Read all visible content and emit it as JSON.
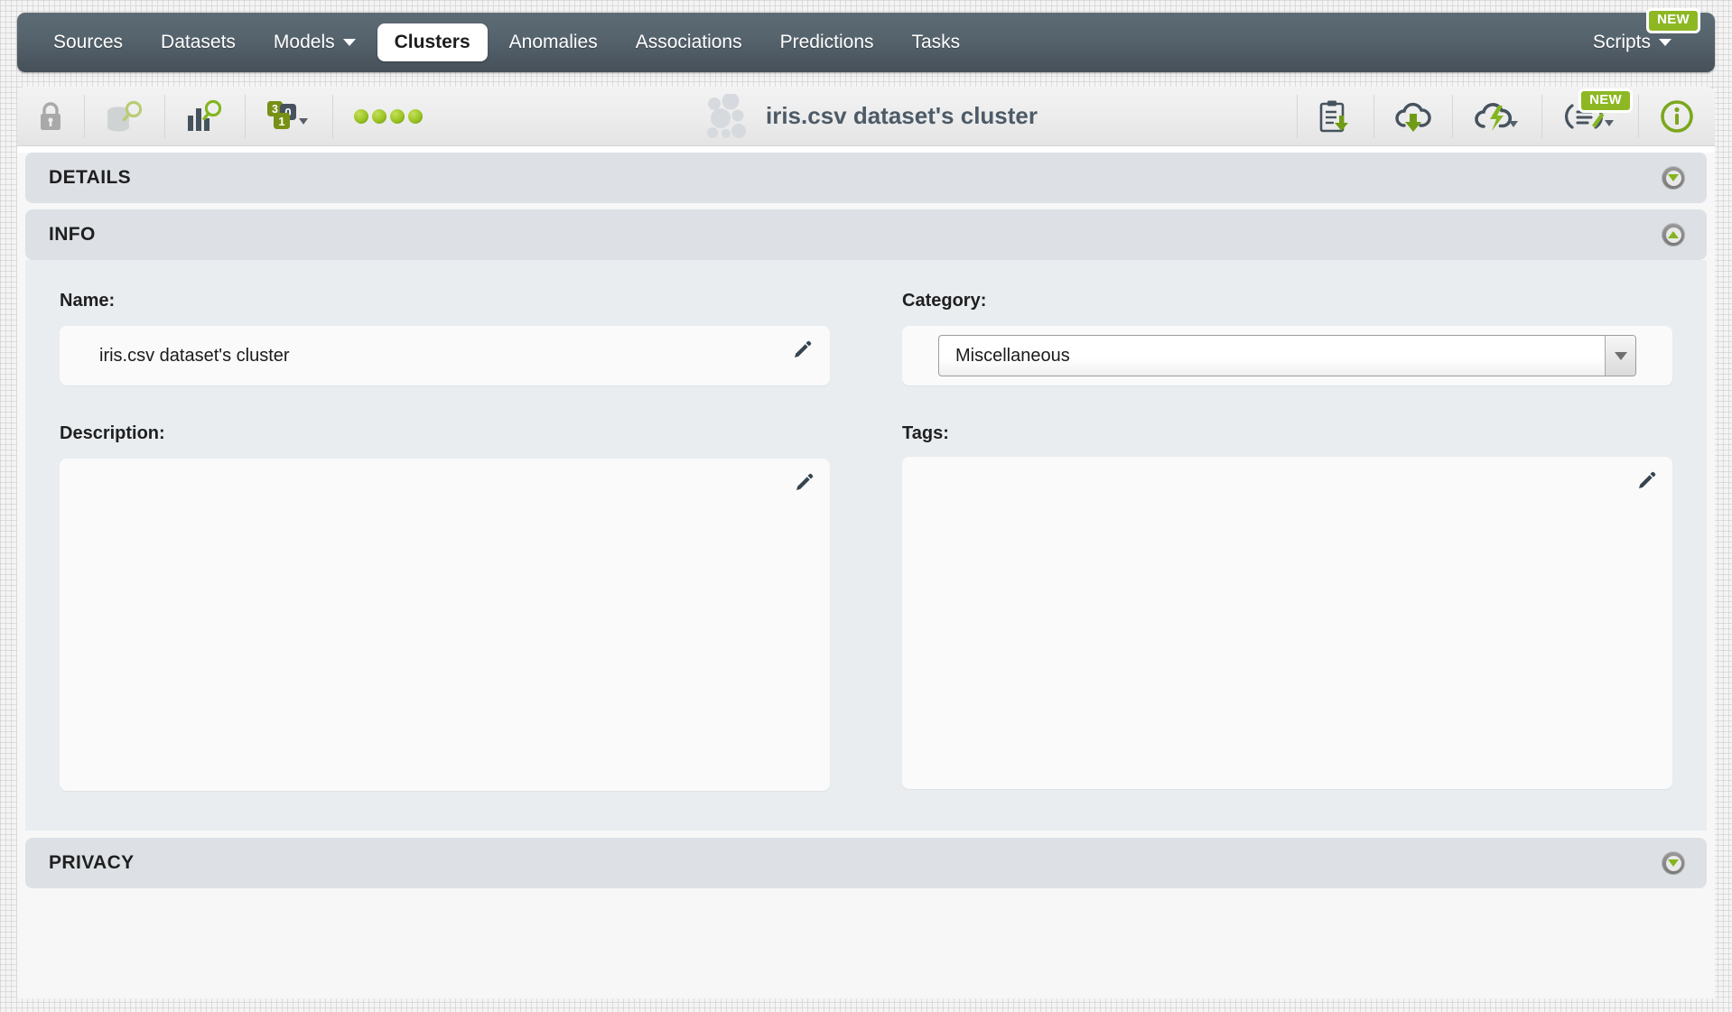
{
  "nav": {
    "items": [
      {
        "label": "Sources",
        "icon": "",
        "active": false,
        "caret": false
      },
      {
        "label": "Datasets",
        "icon": "",
        "active": false,
        "caret": false
      },
      {
        "label": "Models",
        "icon": "",
        "active": false,
        "caret": true
      },
      {
        "label": "Clusters",
        "icon": "",
        "active": true,
        "caret": false
      },
      {
        "label": "Anomalies",
        "icon": "",
        "active": false,
        "caret": false
      },
      {
        "label": "Associations",
        "icon": "",
        "active": false,
        "caret": false
      },
      {
        "label": "Predictions",
        "icon": "",
        "active": false,
        "caret": false
      },
      {
        "label": "Tasks",
        "icon": "",
        "active": false,
        "caret": false
      }
    ],
    "scripts_label": "Scripts",
    "scripts_badge": "NEW",
    "bar_color": "#4e5a64",
    "active_tab_bg": "#ffffff"
  },
  "toolbar": {
    "title": "iris.csv dataset's cluster",
    "cluster_icon": "cluster-dots-icon",
    "left_icons": [
      {
        "name": "lock-icon",
        "label": ""
      },
      {
        "name": "dataset-search-icon",
        "label": ""
      },
      {
        "name": "model-search-icon",
        "label": ""
      },
      {
        "name": "batch-numbers-icon",
        "label": ""
      },
      {
        "name": "status-dots-icon",
        "label": ""
      }
    ],
    "right_icons": [
      {
        "name": "clipboard-download-icon",
        "label": ""
      },
      {
        "name": "cloud-download-icon",
        "label": ""
      },
      {
        "name": "cloud-flash-icon",
        "label": ""
      },
      {
        "name": "script-icon",
        "label": ""
      },
      {
        "name": "info-icon",
        "label": ""
      }
    ],
    "script_badge": "NEW",
    "status_dots_count": 4,
    "status_dot_color": "#9bc422",
    "accent_green": "#8db823"
  },
  "sections": {
    "details": {
      "label": "DETAILS",
      "expanded": false
    },
    "info": {
      "label": "INFO",
      "expanded": true
    },
    "privacy": {
      "label": "PRIVACY",
      "expanded": false
    }
  },
  "info": {
    "name": {
      "label": "Name:",
      "value": "iris.csv dataset's cluster",
      "placeholder": ""
    },
    "category": {
      "label": "Category:",
      "value": "Miscellaneous"
    },
    "description": {
      "label": "Description:",
      "value": "",
      "placeholder": ""
    },
    "tags": {
      "label": "Tags:",
      "value": "",
      "placeholder": ""
    }
  }
}
